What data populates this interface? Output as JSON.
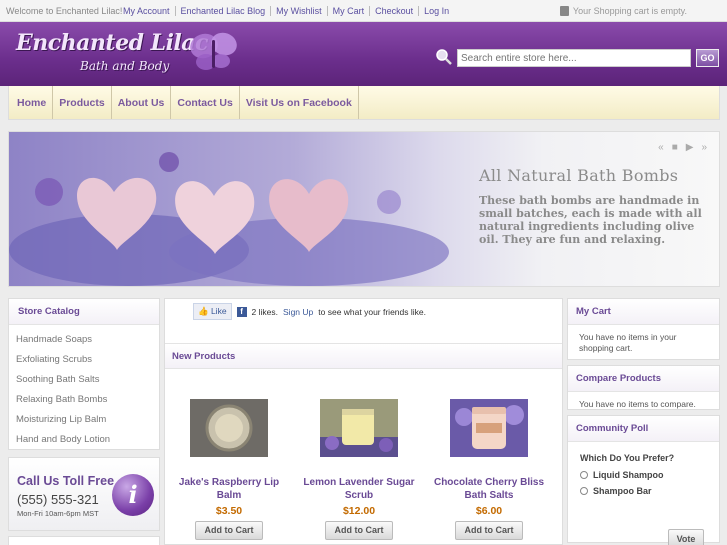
{
  "topbar": {
    "welcome": "Welcome to Enchanted Lilac!",
    "links": [
      "My Account",
      "Enchanted Lilac Blog",
      "My Wishlist",
      "My Cart",
      "Checkout",
      "Log In"
    ],
    "cart_status": "Your Shopping cart is empty."
  },
  "header": {
    "logo_title": "Enchanted Lilac",
    "logo_subtitle": "Bath and Body",
    "search_placeholder": "Search entire store here...",
    "search_button": "GO"
  },
  "nav": [
    "Home",
    "Products",
    "About Us",
    "Contact Us",
    "Visit Us on Facebook"
  ],
  "banner": {
    "title": "All Natural Bath Bombs",
    "text": "These bath bombs are  handmade in small batches,  each is made with all natural ingredients including olive oil. They are fun and relaxing."
  },
  "catalog": {
    "title": "Store Catalog",
    "items": [
      "Handmade Soaps",
      "Exfoliating Scrubs",
      "Soothing Bath Salts",
      "Relaxing Bath Bombs",
      "Moisturizing Lip Balm",
      "Hand and Body Lotion"
    ]
  },
  "tollfree": {
    "heading": "Call Us Toll Free",
    "number": "(555) 555-321",
    "hours": "Mon-Fri 10am-6pm MST",
    "icon_letter": "i"
  },
  "facebook": {
    "like_label": "Like",
    "likes_text": "2 likes.",
    "signup": "Sign Up",
    "suffix": "to see what your friends like."
  },
  "new_products": {
    "title": "New Products",
    "add_label": "Add to Cart",
    "items": [
      {
        "name": "Jake's Raspberry Lip Balm",
        "price": "$3.50"
      },
      {
        "name": "Lemon Lavender Sugar Scrub",
        "price": "$12.00"
      },
      {
        "name": "Chocolate Cherry Bliss Bath Salts",
        "price": "$6.00"
      }
    ]
  },
  "my_cart": {
    "title": "My Cart",
    "text": "You have no items in your shopping cart."
  },
  "compare": {
    "title": "Compare Products",
    "text": "You have no items to compare."
  },
  "poll": {
    "title": "Community Poll",
    "question": "Which Do You Prefer?",
    "options": [
      "Liquid Shampoo",
      "Shampoo Bar"
    ],
    "vote": "Vote"
  },
  "colors": {
    "brand_purple": "#6b2e8c",
    "link": "#5a4fa0",
    "price": "#c36a00",
    "nav_bg": "#fffbe6"
  }
}
